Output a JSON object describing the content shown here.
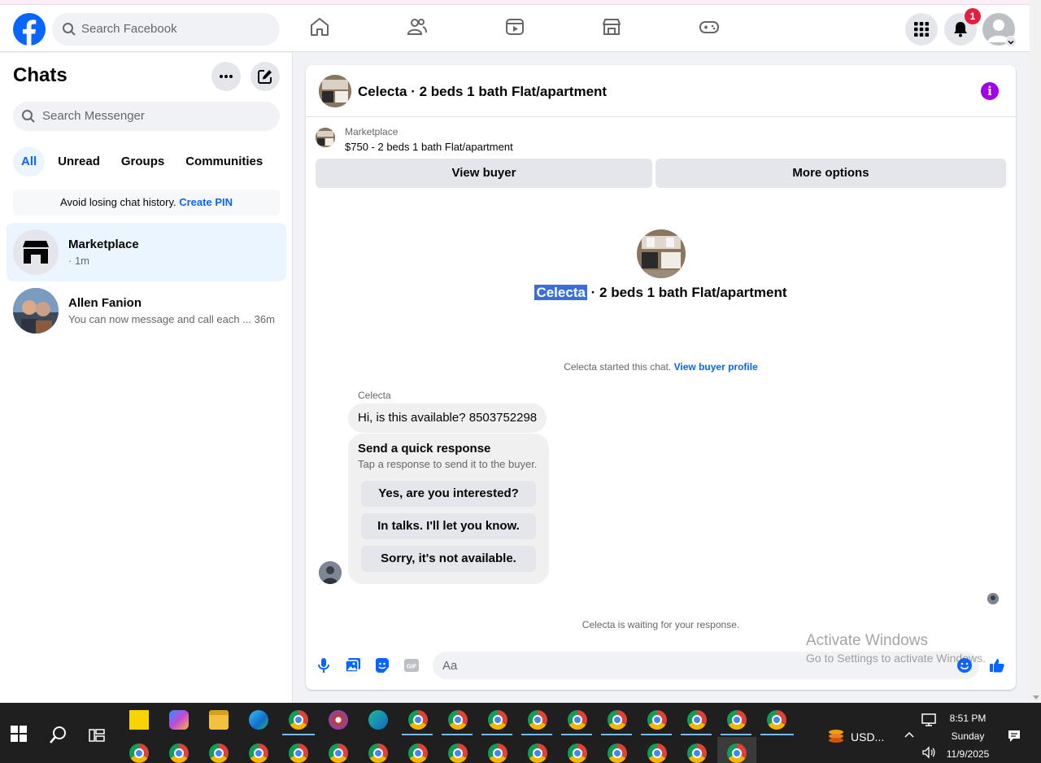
{
  "facebook": {
    "search_placeholder": "Search Facebook",
    "notification_count": "1",
    "nav_icons": [
      "home-icon",
      "friends-icon",
      "watch-icon",
      "marketplace-icon",
      "gaming-icon"
    ]
  },
  "sidebar": {
    "title": "Chats",
    "search_placeholder": "Search Messenger",
    "filters": [
      "All",
      "Unread",
      "Groups",
      "Communities"
    ],
    "active_filter": "All",
    "pin_banner": {
      "text": "Avoid losing chat history.",
      "link": "Create PIN"
    },
    "conversations": [
      {
        "name": "Marketplace",
        "subtitle": "· 1m",
        "active": true
      },
      {
        "name": "Allen Fanion",
        "preview": "You can now message and call each ...",
        "time": "36m",
        "active": false
      }
    ]
  },
  "chat": {
    "title": "Celecta · 2 beds 1 bath Flat/apartment",
    "marketplace_label": "Marketplace",
    "listing": "$750 - 2 beds 1 bath Flat/apartment",
    "view_buyer": "View buyer",
    "more_options": "More options",
    "center_name": "Celecta",
    "center_rest": " · 2 beds 1 bath Flat/apartment",
    "started_text": "Celecta started this chat.",
    "started_link": "View buyer profile",
    "sender": "Celecta",
    "message": "Hi, is this available? 8503752298",
    "quick_title": "Send a quick response",
    "quick_subtitle": "Tap a response to send it to the buyer.",
    "quick_responses": [
      "Yes, are you interested?",
      "In talks. I'll let you know.",
      "Sorry, it's not available."
    ],
    "waiting": "Celecta is waiting for your response.",
    "composer_placeholder": "Aa"
  },
  "watermark": {
    "line1": "Activate Windows",
    "line2": "Go to Settings to activate Windows."
  },
  "taskbar": {
    "currency": "USD...",
    "time": "8:51 PM",
    "day": "Sunday",
    "date": "11/9/2025"
  },
  "colors": {
    "brand": "#0866ff",
    "info": "#a100e6",
    "badge": "#e41e3f"
  }
}
